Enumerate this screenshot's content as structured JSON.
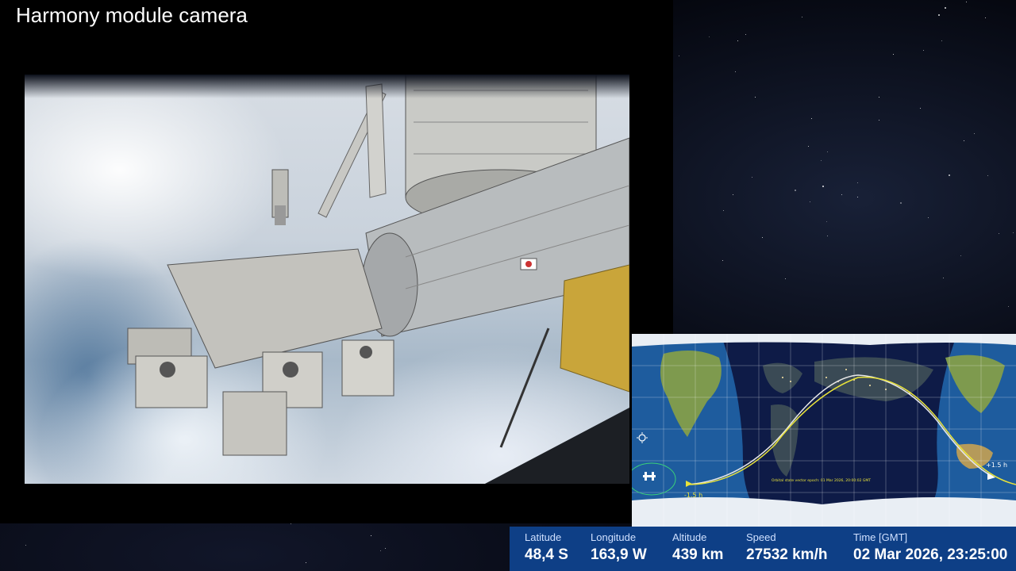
{
  "camera": {
    "title": "Harmony module camera"
  },
  "map": {
    "epoch_text": "Orbital state vector epoch: 01 Mar 2026, 20:00:02 GMT",
    "minus_label": "-1.5 h",
    "plus_label": "+1.5 h",
    "sun_icon": "sun-icon",
    "station_icon": "iss-icon"
  },
  "telemetry": {
    "latitude": {
      "label": "Latitude",
      "value": "48,4 S"
    },
    "longitude": {
      "label": "Longitude",
      "value": "163,9 W"
    },
    "altitude": {
      "label": "Altitude",
      "value": "439 km"
    },
    "speed": {
      "label": "Speed",
      "value": "27532 km/h"
    },
    "time": {
      "label": "Time [GMT]",
      "value": "02 Mar 2026, 23:25:00"
    }
  },
  "colors": {
    "ground_track": "#e8e23a",
    "past_track": "#e8e8e8",
    "telemetry_bar": "#0e3f86",
    "ocean": "#1e5c9e"
  }
}
